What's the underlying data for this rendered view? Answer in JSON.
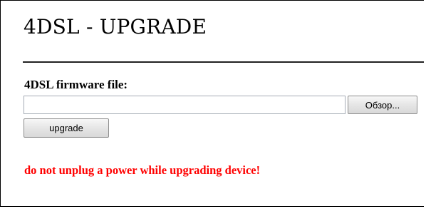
{
  "page": {
    "title": "4DSL - UPGRADE"
  },
  "form": {
    "file_label": "4DSL firmware file:",
    "file_value": "",
    "browse_label": "Обзор...",
    "submit_label": "upgrade"
  },
  "warning": {
    "text": "do not unplug a power while upgrading device!",
    "color": "#ff0000"
  }
}
